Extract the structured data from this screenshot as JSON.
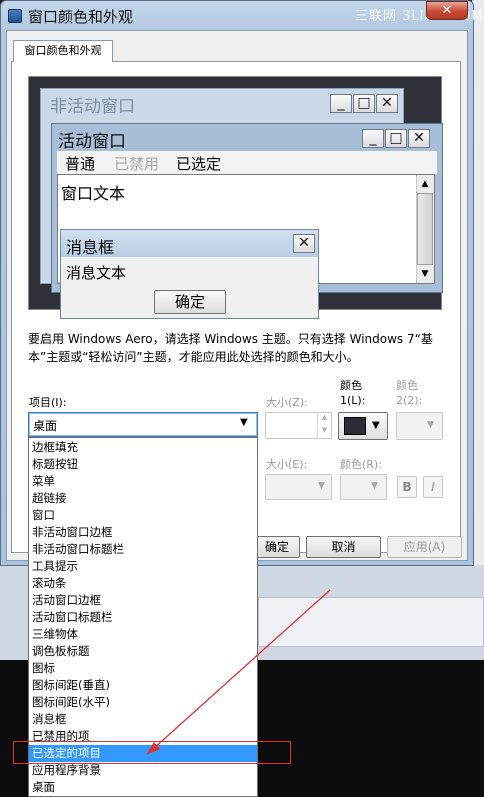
{
  "window": {
    "title": "窗口颜色和外观",
    "watermark": "三联网 3LIAN.COM",
    "close_glyph": "✕",
    "tab_label": "窗口颜色和外观"
  },
  "preview": {
    "inactive_title": "非活动窗口",
    "active_title": "活动窗口",
    "menu": [
      "普通",
      "已禁用",
      "已选定"
    ],
    "window_text": "窗口文本",
    "msgbox_title": "消息框",
    "msgbox_text": "消息文本",
    "ok_label": "确定",
    "btn_min": "_",
    "btn_max": "□",
    "btn_close": "✕",
    "scroll_up": "▲",
    "scroll_down": "▼"
  },
  "description": "要启用 Windows Aero，请选择 Windows 主题。只有选择 Windows 7“基本”主题或“轻松访问”主题，才能应用此处选择的颜色和大小。",
  "controls": {
    "item_label": "项目(I):",
    "item_value": "桌面",
    "size_label": "大小(Z):",
    "color1_label_a": "颜色",
    "color1_label_b": "1(L):",
    "color2_label_a": "颜色",
    "color2_label_b": "2(2):",
    "font_size_label": "大小(E):",
    "font_color_label": "颜色(R):",
    "bold_label": "B",
    "italic_label": "I",
    "spin_up": "▲",
    "spin_down": "▼",
    "dropdown_arrow": "▼",
    "color1_value": "#2b2b33"
  },
  "dialog_buttons": {
    "ok": "确定",
    "cancel": "取消",
    "apply": "应用(A)"
  },
  "dropdown": {
    "selected_index": 18,
    "items": [
      "边框填充",
      "标题按钮",
      "菜单",
      "超链接",
      "窗口",
      "非活动窗口边框",
      "非活动窗口标题栏",
      "工具提示",
      "滚动条",
      "活动窗口边框",
      "活动窗口标题栏",
      "三维物体",
      "调色板标题",
      "图标",
      "图标间距(垂直)",
      "图标间距(水平)",
      "消息框",
      "已禁用的项",
      "已选定的项目",
      "应用程序背景",
      "桌面"
    ]
  },
  "annotation": {
    "highlight_color": "#e03030"
  }
}
